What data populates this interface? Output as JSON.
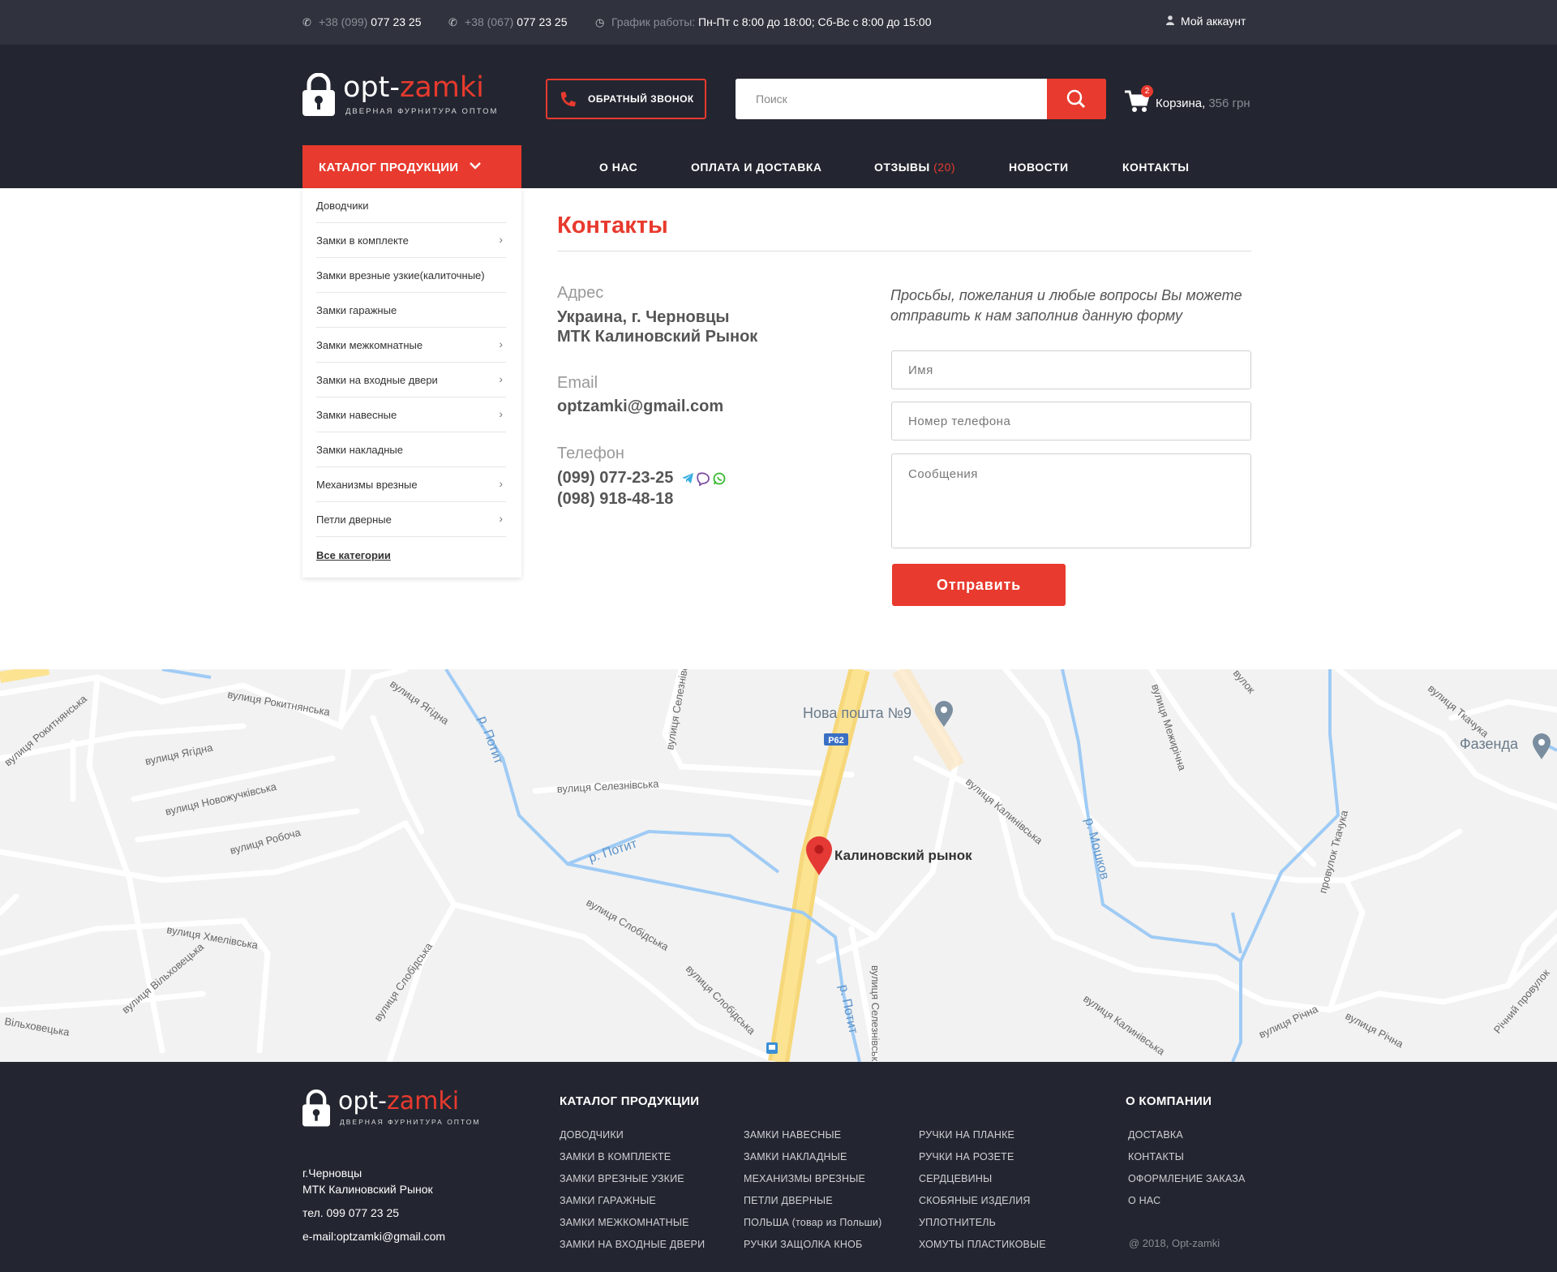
{
  "topbar": {
    "phone1_prefix": "+38 (099)",
    "phone1_number": "077 23 25",
    "phone2_prefix": "+38 (067)",
    "phone2_number": "077 23 25",
    "schedule_label": "График работы:",
    "schedule_value": "Пн-Пт с 8:00 до 18:00; Сб-Вс с  8:00 до 15:00",
    "account_label": "Мой аккаунт",
    "icons": {
      "phone": "phone-icon",
      "clock": "clock-icon",
      "user": "user-icon"
    }
  },
  "header": {
    "logo_opt": "opt-",
    "logo_zamki": "zamki",
    "logo_tagline": "ДВЕРНАЯ ФУРНИТУРА ОПТОМ",
    "callback_label": "ОБРАТНЫЙ ЗВОНОК",
    "search_placeholder": "Поиск",
    "cart_count": "2",
    "cart_label": "Корзина,",
    "cart_sum": "356 грн"
  },
  "nav": {
    "catalog_label": "КАТАЛОГ ПРОДУКЦИИ",
    "links": [
      {
        "label": "О НАС"
      },
      {
        "label": "ОПЛАТА И ДОСТАВКА"
      },
      {
        "label": "ОТЗЫВЫ",
        "count": "(20)"
      },
      {
        "label": "НОВОСТИ"
      },
      {
        "label": "КОНТАКТЫ"
      }
    ]
  },
  "sidebar": {
    "items": [
      {
        "label": "Доводчики",
        "has_sub": false
      },
      {
        "label": "Замки в комплекте",
        "has_sub": true
      },
      {
        "label": "Замки врезные узкие(калиточные)",
        "has_sub": false
      },
      {
        "label": "Замки гаражные",
        "has_sub": false
      },
      {
        "label": "Замки межкомнатные",
        "has_sub": true
      },
      {
        "label": "Замки на входные двери",
        "has_sub": true
      },
      {
        "label": "Замки навесные",
        "has_sub": true
      },
      {
        "label": "Замки накладные",
        "has_sub": false
      },
      {
        "label": "Механизмы врезные",
        "has_sub": true
      },
      {
        "label": "Петли дверные",
        "has_sub": true
      }
    ],
    "all_label": "Все категории"
  },
  "contacts": {
    "title": "Контакты",
    "address_label": "Адрес",
    "address_line1": "Украина, г. Черновцы",
    "address_line2": "МТК Калиновский Рынок",
    "email_label": "Email",
    "email_value": "optzamki@gmail.com",
    "phone_label": "Телефон",
    "phone1": "(099) 077-23-25",
    "phone2": "(098) 918-48-18",
    "messenger_icons": [
      "telegram-icon",
      "viber-icon",
      "whatsapp-icon"
    ]
  },
  "form": {
    "note": "Просьбы, пожелания и любые вопросы Вы можете отправить к нам заполнив данную форму",
    "name_placeholder": "Имя",
    "phone_placeholder": "Номер телефона",
    "message_placeholder": "Сообщения",
    "submit_label": "Отправить"
  },
  "map": {
    "marker_label": "Калиновский рынок",
    "poi1": "Нова пошта №9",
    "poi2": "Фазенда",
    "road_badge": "P62",
    "streets": [
      "вулиця Рокитнянська",
      "вулиця Ягідна",
      "вулиця Ягідна",
      "вулиця Новожучківська",
      "вулиця Робоча",
      "вулиця Рокитнянська",
      "вулиця Селезнівська",
      "вулиця Селезнівська",
      "р. Потит",
      "р. Потит",
      "р. Потит",
      "вулиця Хмелівська",
      "вулиця Вільховецька",
      "Вільховецька",
      "вулиця Слобідська",
      "вулиця Слобідська",
      "вулиця Слобідська",
      "вулиця Калинівська",
      "вулиця Калинівська",
      "вулиця Селезнівська",
      "р. Мошков",
      "вулиця Межирічна",
      "вулиця Ткачука",
      "провулок Ткачука",
      "вулиця Річна",
      "вулиця Річна",
      "Річний провулок",
      "вулок"
    ]
  },
  "footer": {
    "logo_opt": "opt-",
    "logo_zamki": "zamki",
    "logo_tagline": "ДВЕРНАЯ ФУРНИТУРА ОПТОМ",
    "city": "г.Черновцы",
    "market": "МТК Калиновский Рынок",
    "tel": "тел. 099 077 23 25",
    "email": "e-mail:optzamki@gmail.com",
    "catalog_heading": "КАТАЛОГ ПРОДУКЦИИ",
    "catalog_col1": [
      "ДОВОДЧИКИ",
      "ЗАМКИ В КОМПЛЕКТЕ",
      "ЗАМКИ ВРЕЗНЫЕ УЗКИЕ",
      "ЗАМКИ ГАРАЖНЫЕ",
      "ЗАМКИ МЕЖКОМНАТНЫЕ",
      "ЗАМКИ НА ВХОДНЫЕ ДВЕРИ"
    ],
    "catalog_col2": [
      "ЗАМКИ НАВЕСНЫЕ",
      "ЗАМКИ НАКЛАДНЫЕ",
      "МЕХАНИЗМЫ ВРЕЗНЫЕ",
      "ПЕТЛИ ДВЕРНЫЕ",
      "ПОЛЬША (товар из Польши)",
      "РУЧКИ ЗАЩОЛКА КНОБ"
    ],
    "catalog_col3": [
      "РУЧКИ НА ПЛАНКЕ",
      "РУЧКИ НА РОЗЕТЕ",
      "СЕРДЦЕВИНЫ",
      "СКОБЯНЫЕ ИЗДЕЛИЯ",
      "УПЛОТНИТЕЛЬ",
      "ХОМУТЫ ПЛАСТИКОВЫЕ"
    ],
    "company_heading": "О КОМПАНИИ",
    "company_links": [
      "ДОСТАВКА",
      "КОНТАКТЫ",
      "ОФОРМЛЕНИЕ ЗАКАЗА",
      "О НАС"
    ],
    "copyright": "@ 2018, Opt-zamki"
  },
  "colors": {
    "accent": "#e83a2e",
    "dark": "#232630",
    "topbar": "#30333d"
  }
}
